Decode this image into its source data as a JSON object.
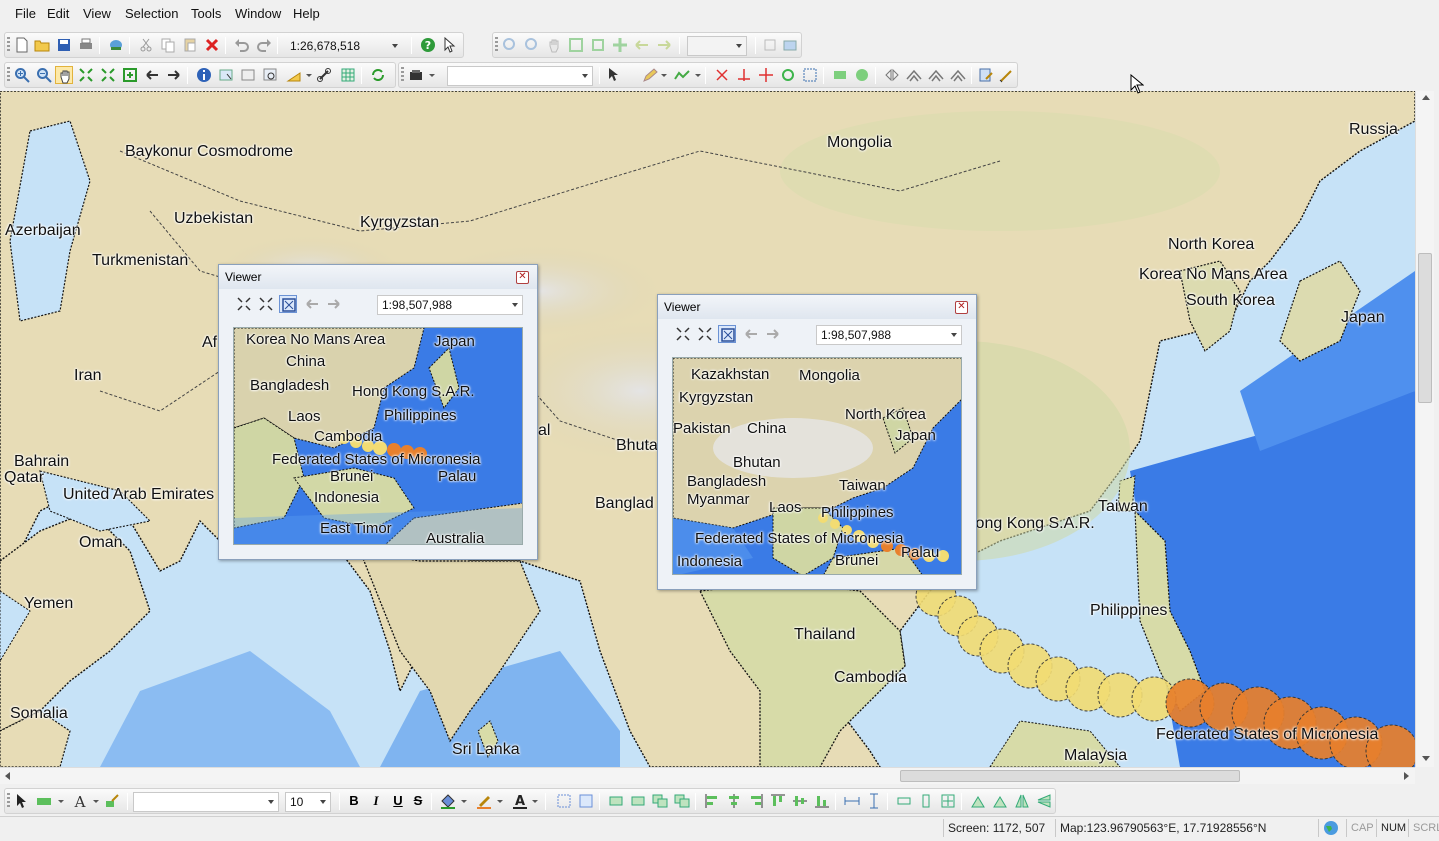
{
  "menu": [
    "File",
    "Edit",
    "View",
    "Selection",
    "Tools",
    "Window",
    "Help"
  ],
  "toolbar": {
    "scale_value": "1:26,678,518",
    "disabled_scale_value": "",
    "layer_select_value": "",
    "font_name_value": "",
    "font_size_value": "10",
    "bold_label": "B",
    "italic_label": "I",
    "underline_label": "U",
    "strike_label": "S"
  },
  "map": {
    "labels": [
      {
        "text": "Baykonur Cosmodrome"
      },
      {
        "text": "Mongolia"
      },
      {
        "text": "Russia"
      },
      {
        "text": "Uzbekistan"
      },
      {
        "text": "Kyrgyzstan"
      },
      {
        "text": "Azerbaijan"
      },
      {
        "text": "Turkmenistan"
      },
      {
        "text": "North Korea"
      },
      {
        "text": "Korea No Mans Area"
      },
      {
        "text": "South Korea"
      },
      {
        "text": "Japan"
      },
      {
        "text": "Af"
      },
      {
        "text": "Iran"
      },
      {
        "text": "Bahrain"
      },
      {
        "text": "Qatar"
      },
      {
        "text": "United Arab Emirates"
      },
      {
        "text": "Oman"
      },
      {
        "text": "Yemen"
      },
      {
        "text": "Somalia"
      },
      {
        "text": "Bhutan"
      },
      {
        "text": "al"
      },
      {
        "text": "Banglad"
      },
      {
        "text": "Hong Kong S.A.R."
      },
      {
        "text": "Taiwan"
      },
      {
        "text": "Philippines"
      },
      {
        "text": "Thailand"
      },
      {
        "text": "Cambodia"
      },
      {
        "text": "Sri Lanka"
      },
      {
        "text": "Malaysia"
      },
      {
        "text": "Federated States of Micronesia"
      }
    ]
  },
  "viewers": [
    {
      "title": "Viewer",
      "scale": "1:98,507,988",
      "labels": [
        {
          "text": "Korea No Mans Area"
        },
        {
          "text": "Japan"
        },
        {
          "text": "China"
        },
        {
          "text": "Bangladesh"
        },
        {
          "text": "Hong Kong S.A.R."
        },
        {
          "text": "Laos"
        },
        {
          "text": "Philippines"
        },
        {
          "text": "Cambodia"
        },
        {
          "text": "Federated States of Micronesia"
        },
        {
          "text": "Brunei"
        },
        {
          "text": "Palau"
        },
        {
          "text": "Indonesia"
        },
        {
          "text": "East Timor"
        },
        {
          "text": "Australia"
        }
      ]
    },
    {
      "title": "Viewer",
      "scale": "1:98,507,988",
      "labels": [
        {
          "text": "Kazakhstan"
        },
        {
          "text": "Mongolia"
        },
        {
          "text": "Kyrgyzstan"
        },
        {
          "text": "North Korea"
        },
        {
          "text": "Pakistan"
        },
        {
          "text": "China"
        },
        {
          "text": "Japan"
        },
        {
          "text": "Bhutan"
        },
        {
          "text": "Bangladesh"
        },
        {
          "text": "Taiwan"
        },
        {
          "text": "Myanmar"
        },
        {
          "text": "Laos"
        },
        {
          "text": "Philippines"
        },
        {
          "text": "Federated States of Micronesia"
        },
        {
          "text": "Palau"
        },
        {
          "text": "Indonesia"
        },
        {
          "text": "Brunei"
        }
      ]
    }
  ],
  "status": {
    "screen": "Screen: 1172, 507",
    "mapcoord": "Map:123.96790563°E, 17.71928556°N",
    "cap": "CAP",
    "num": "NUM",
    "scrl": "SCRL"
  },
  "colors": {
    "land": "#e7dcb6",
    "land_green": "#cfd9a6",
    "mountain": "#d8d8d8",
    "ocean_light": "#c6e2f7",
    "ocean_mid": "#5c9ef0",
    "ocean_deep": "#2f6fe6",
    "storm_yellow": "#f2dc73",
    "storm_orange": "#e8802c"
  }
}
